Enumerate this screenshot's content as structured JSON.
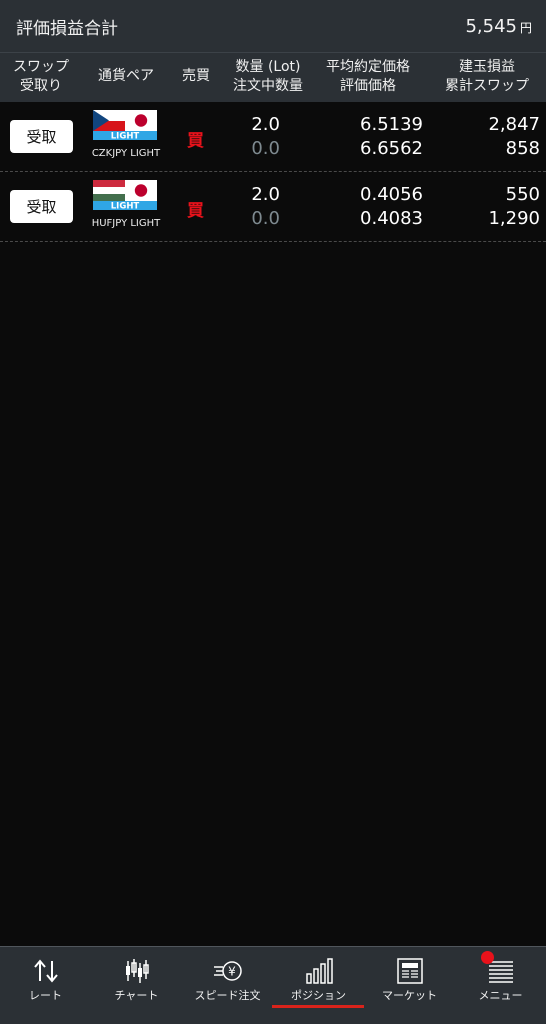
{
  "summary": {
    "title": "評価損益合計",
    "value": "5,545",
    "unit": "円"
  },
  "header": {
    "swap_line1": "スワップ",
    "swap_line2": "受取り",
    "pair": "通貨ペア",
    "side": "売買",
    "qty_line1": "数量 (Lot)",
    "qty_line2": "注文中数量",
    "price_line1": "平均約定価格",
    "price_line2": "評価価格",
    "pl_line1": "建玉損益",
    "pl_line2": "累計スワップ"
  },
  "rows": [
    {
      "receive_label": "受取",
      "flag_label": "LIGHT",
      "pair_name": "CZKJPY LIGHT",
      "side": "買",
      "qty": "2.0",
      "order_qty": "0.0",
      "avg_price": "6.5139",
      "eval_price": "6.6562",
      "position_pl": "2,847",
      "swap": "858"
    },
    {
      "receive_label": "受取",
      "flag_label": "LIGHT",
      "pair_name": "HUFJPY LIGHT",
      "side": "買",
      "qty": "2.0",
      "order_qty": "0.0",
      "avg_price": "0.4056",
      "eval_price": "0.4083",
      "position_pl": "550",
      "swap": "1,290"
    }
  ],
  "tabs": [
    {
      "label": "レート",
      "icon": "rate-arrows-icon"
    },
    {
      "label": "チャート",
      "icon": "candlestick-icon"
    },
    {
      "label": "スピード注文",
      "icon": "speed-order-icon"
    },
    {
      "label": "ポジション",
      "icon": "bar-chart-icon",
      "active": true
    },
    {
      "label": "マーケット",
      "icon": "newspaper-icon"
    },
    {
      "label": "メニュー",
      "icon": "menu-icon"
    }
  ],
  "colors": {
    "buy": "#e8121b",
    "active_tab": "#d9231b",
    "bar": "#2b3035"
  }
}
